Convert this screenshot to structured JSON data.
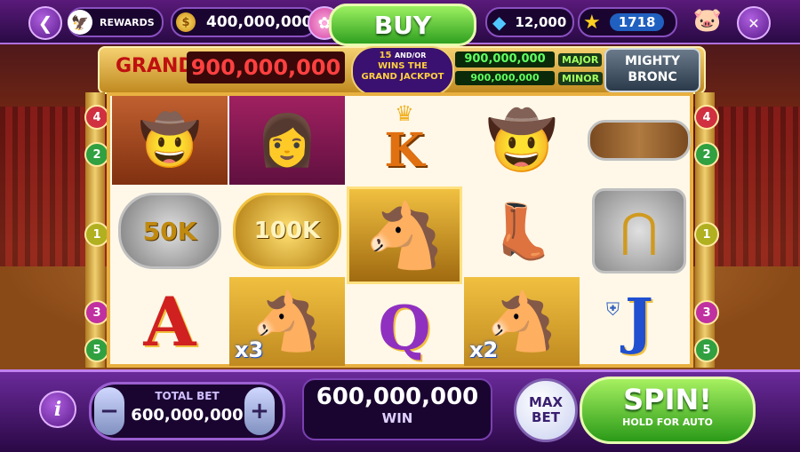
{
  "top_bar": {
    "back_icon": "chevron-left-icon",
    "rewards_label": "REWARDS",
    "coin_symbol": "$",
    "coin_balance": "400,000,000",
    "buy_label": "BUY",
    "gems": "12,000",
    "stars": "1718"
  },
  "jackpot": {
    "grand_label": "GRAND",
    "grand_value": "900,000,000",
    "promo_count": "15",
    "promo_and_or": "AND/OR",
    "promo_line1": "WINS THE",
    "promo_line2": "GRAND JACKPOT",
    "major_value": "900,000,000",
    "major_label": "MAJOR",
    "minor_value": "900,000,000",
    "minor_label": "MINOR",
    "game_title_1": "MIGHTY",
    "game_title_2": "BRONC"
  },
  "paylines": {
    "left": [
      "4",
      "2",
      "1",
      "3",
      "5"
    ],
    "right": [
      "4",
      "2",
      "1",
      "3",
      "5"
    ]
  },
  "reels": {
    "col1": [
      "cowboy-man",
      "50K",
      "A"
    ],
    "col2": [
      "cowgirl",
      "100K",
      "horse-x3"
    ],
    "col3": [
      "K",
      "horse-wild",
      "Q"
    ],
    "col4": [
      "cowboy-hat",
      "boots",
      "horse-x2"
    ],
    "col5": [
      "belt-buckle",
      "horseshoe-bronc",
      "J"
    ],
    "labels": {
      "k50": "50K",
      "k100": "100K",
      "letter_a": "A",
      "letter_k": "K",
      "letter_q": "Q",
      "letter_j": "J",
      "mult3": "x3",
      "mult2": "x2"
    }
  },
  "bottom_bar": {
    "info_label": "i",
    "minus_label": "−",
    "plus_label": "+",
    "total_bet_label": "TOTAL BET",
    "total_bet_value": "600,000,000",
    "win_value": "600,000,000",
    "win_label": "WIN",
    "max_bet_line1": "MAX",
    "max_bet_line2": "BET",
    "spin_label": "SPIN!",
    "spin_sub": "HOLD FOR AUTO"
  },
  "colors": {
    "buy_green": "#2fa020",
    "spin_green": "#2a9a18",
    "jackpot_red": "#c01010",
    "frame_gold": "#e8b040",
    "purple": "#5a1a7a"
  }
}
